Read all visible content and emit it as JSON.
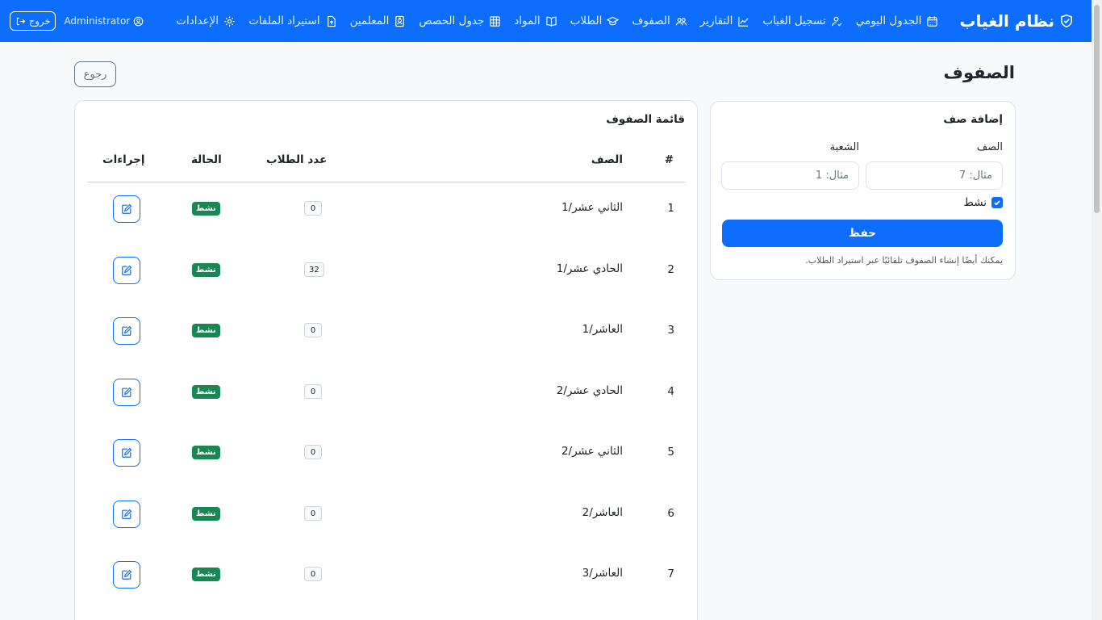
{
  "app": {
    "brand": "نظام الغياب",
    "colors": {
      "primary": "#0d6efd",
      "success": "#198754"
    }
  },
  "nav": {
    "items": [
      {
        "label": "الجدول اليومي",
        "icon": "calendar-icon"
      },
      {
        "label": "تسجيل الغياب",
        "icon": "user-check-icon"
      },
      {
        "label": "التقارير",
        "icon": "chart-line-icon"
      },
      {
        "label": "الصفوف",
        "icon": "people-icon"
      },
      {
        "label": "الطلاب",
        "icon": "graduation-cap-icon"
      },
      {
        "label": "المواد",
        "icon": "book-icon"
      },
      {
        "label": "جدول الحصص",
        "icon": "grid-icon"
      },
      {
        "label": "المعلمين",
        "icon": "person-badge-icon"
      },
      {
        "label": "استيراد الملفات",
        "icon": "file-upload-icon"
      },
      {
        "label": "الإعدادات",
        "icon": "gear-icon"
      }
    ],
    "user": "Administrator",
    "logout": "خروج"
  },
  "page": {
    "title": "الصفوف",
    "back": "رجوع"
  },
  "form": {
    "title": "إضافة صف",
    "grade_label": "الصف",
    "grade_placeholder": "مثال: 7",
    "section_label": "الشعبة",
    "section_placeholder": "مثال: 1",
    "active_label": "نشط",
    "save": "حفظ",
    "hint": "يمكنك أيضًا إنشاء الصفوف تلقائيًا عبر استيراد الطلاب."
  },
  "list": {
    "title": "قائمة الصفوف",
    "headers": {
      "num": "#",
      "name": "الصف",
      "count": "عدد الطلاب",
      "status": "الحالة",
      "actions": "إجراءات"
    },
    "rows": [
      {
        "num": "1",
        "name": "الثاني عشر/1",
        "count": "0",
        "status": "نشط"
      },
      {
        "num": "2",
        "name": "الحادي عشر/1",
        "count": "32",
        "status": "نشط"
      },
      {
        "num": "3",
        "name": "العاشر/1",
        "count": "0",
        "status": "نشط"
      },
      {
        "num": "4",
        "name": "الحادي عشر/2",
        "count": "0",
        "status": "نشط"
      },
      {
        "num": "5",
        "name": "الثاني عشر/2",
        "count": "0",
        "status": "نشط"
      },
      {
        "num": "6",
        "name": "العاشر/2",
        "count": "0",
        "status": "نشط"
      },
      {
        "num": "7",
        "name": "العاشر/3",
        "count": "0",
        "status": "نشط"
      }
    ]
  }
}
